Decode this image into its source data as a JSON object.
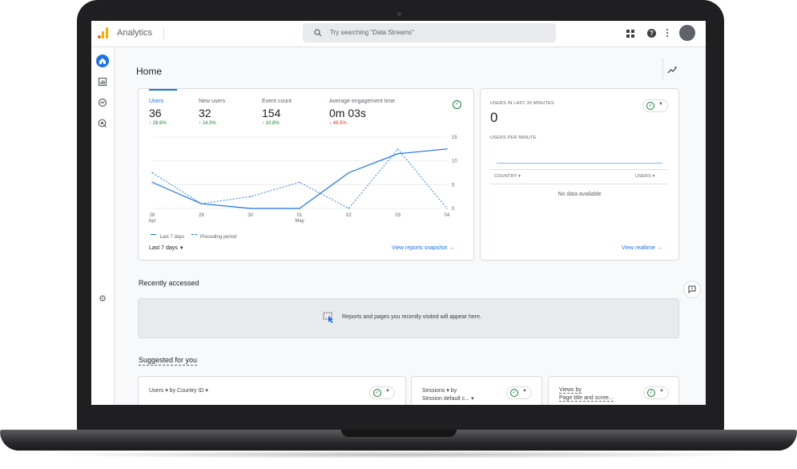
{
  "app": {
    "title": "Analytics"
  },
  "search": {
    "placeholder": "Try searching \"Data Streams\""
  },
  "header": {
    "title": "Home"
  },
  "metrics": [
    {
      "label": "Users",
      "value": "36",
      "delta": "↑ 28.6%",
      "direction": "up"
    },
    {
      "label": "New users",
      "value": "32",
      "delta": "↑ 14.3%",
      "direction": "up"
    },
    {
      "label": "Event count",
      "value": "154",
      "delta": "↑ 10.8%",
      "direction": "up"
    },
    {
      "label": "Average engagement time",
      "value": "0m 03s",
      "delta": "↓ 48.5%",
      "direction": "down"
    }
  ],
  "chart_data": {
    "type": "line",
    "categories": [
      "28 Apr",
      "29",
      "30",
      "01 May",
      "02",
      "03",
      "04"
    ],
    "series": [
      {
        "name": "Last 7 days",
        "values": [
          5.5,
          1.0,
          0.0,
          0.0,
          7.5,
          11.5,
          12.5
        ],
        "style": "solid"
      },
      {
        "name": "Preceding period",
        "values": [
          7.5,
          1.0,
          2.5,
          5.5,
          0.0,
          12.5,
          0.0
        ],
        "style": "dashed"
      }
    ],
    "ylim": [
      0,
      15
    ],
    "yticks": [
      "15",
      "10",
      "5",
      "0"
    ],
    "xtick_lines": [
      [
        "28",
        "Apr"
      ],
      [
        "29",
        ""
      ],
      [
        "30",
        ""
      ],
      [
        "01",
        "May"
      ],
      [
        "02",
        ""
      ],
      [
        "03",
        ""
      ],
      [
        "04",
        ""
      ]
    ],
    "grid": true,
    "legend": "bottom-left",
    "color": "#1a73e8"
  },
  "overview": {
    "date_range": "Last 7 days",
    "link": "View reports snapshot →"
  },
  "realtime": {
    "title": "USERS IN LAST 30 MINUTES",
    "value": "0",
    "per_minute": "USERS PER MINUTE",
    "col_country": "COUNTRY ▾",
    "col_users": "USERS ▾",
    "empty": "No data available",
    "link": "View realtime →"
  },
  "recent": {
    "title": "Recently accessed",
    "empty": "Reports and pages you recently visited will appear here."
  },
  "suggested": {
    "title": "Suggested for you",
    "cards": [
      {
        "line1": "Users ▾ by Country ID ▾",
        "line2": ""
      },
      {
        "line1": "Sessions ▾ by",
        "line2": "Session default c... ▾"
      },
      {
        "line1": "Views by",
        "line2": "Page title and scree..."
      }
    ]
  },
  "colors": {
    "accent": "#1a73e8",
    "positive": "#188038",
    "negative": "#d93025",
    "logo_orange": "#f9ab00",
    "logo_dark": "#e37400"
  },
  "icons": [
    "search-icon",
    "apps-icon",
    "help-icon",
    "more-vert-icon",
    "avatar",
    "home-icon",
    "reports-icon",
    "explore-icon",
    "advertising-icon",
    "settings-icon",
    "insights-icon",
    "feedback-icon",
    "check-circle-icon"
  ]
}
